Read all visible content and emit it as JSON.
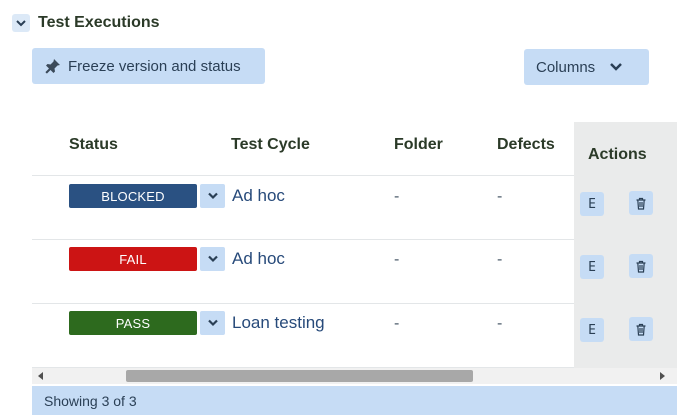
{
  "section": {
    "title": "Test Executions",
    "collapse_icon": "chevron-down-icon"
  },
  "toolbar": {
    "freeze_label": "Freeze version and status",
    "freeze_icon": "pin-icon",
    "columns_label": "Columns",
    "columns_icon": "chevron-down-icon"
  },
  "table": {
    "headers": {
      "status": "Status",
      "test_cycle": "Test Cycle",
      "folder": "Folder",
      "defects": "Defects",
      "actions": "Actions"
    },
    "rows": [
      {
        "status": "BLOCKED",
        "status_color": "#2a5182",
        "test_cycle": "Ad hoc",
        "folder": "-",
        "defects": "-",
        "edit_label": "E",
        "delete_icon": "trash-icon"
      },
      {
        "status": "FAIL",
        "status_color": "#cc1414",
        "test_cycle": "Ad hoc",
        "folder": "-",
        "defects": "-",
        "edit_label": "E",
        "delete_icon": "trash-icon"
      },
      {
        "status": "PASS",
        "status_color": "#2d6a1e",
        "test_cycle": "Loan testing",
        "folder": "-",
        "defects": "-",
        "edit_label": "E",
        "delete_icon": "trash-icon"
      }
    ]
  },
  "footer": {
    "text": "Showing 3 of 3"
  },
  "colors": {
    "accent_button": "#c6dcf5",
    "header_text": "#2b3a28",
    "link": "#274a7a"
  }
}
